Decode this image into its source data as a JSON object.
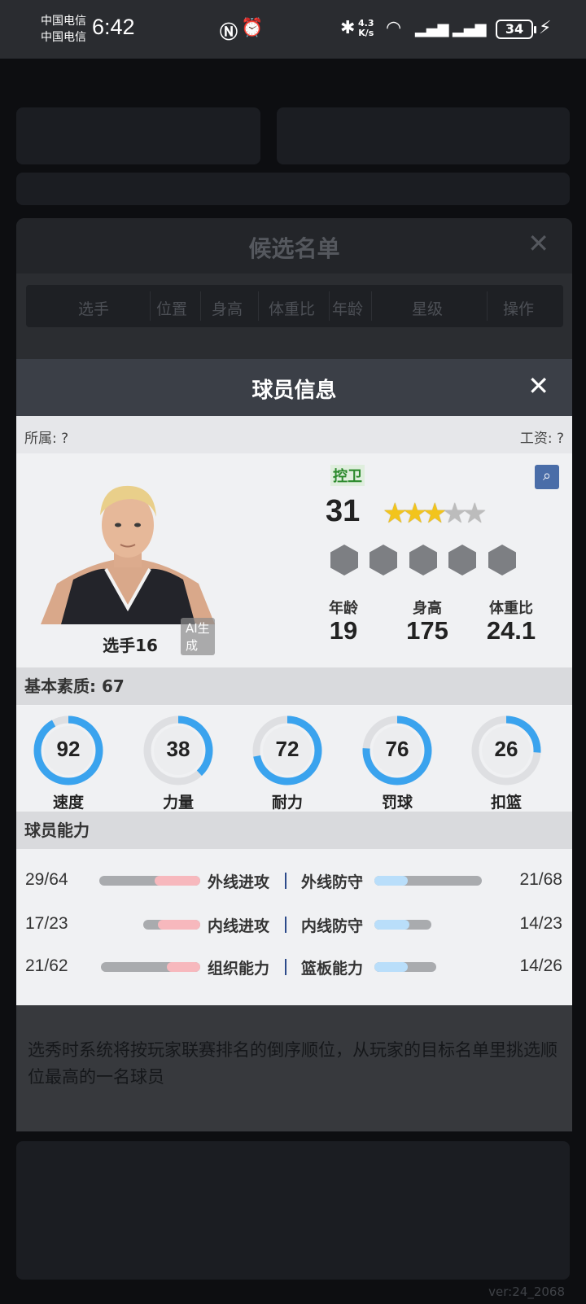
{
  "status_bar": {
    "carrier1": "中国电信",
    "carrier2": "中国电信",
    "time": "6:42",
    "net_speed_top": "4.3",
    "net_speed_bottom": "K/s",
    "battery": "34"
  },
  "candidate_list": {
    "title": "候选名单",
    "columns": [
      "选手",
      "位置",
      "身高",
      "体重比",
      "年龄",
      "星级",
      "操作"
    ],
    "description": "选秀时系统将按玩家联赛排名的倒序顺位，从玩家的目标名单里挑选顺位最高的一名球员"
  },
  "dialog": {
    "title": "球员信息",
    "affiliation": "所属: ?",
    "salary": "工资: ?",
    "player": {
      "name": "选手16",
      "ai_tag": "AI生成",
      "position": "控卫",
      "rating": "31",
      "stars_filled": 3,
      "stars_total": 5,
      "age_label": "年龄",
      "age": "19",
      "height_label": "身高",
      "height": "175",
      "weight_label": "体重比",
      "weight": "24.1"
    },
    "basic_quality_title": "基本素质: 67",
    "attributes": [
      {
        "label": "速度",
        "value": 92
      },
      {
        "label": "力量",
        "value": 38
      },
      {
        "label": "耐力",
        "value": 72
      },
      {
        "label": "罚球",
        "value": 76
      },
      {
        "label": "扣篮",
        "value": 26
      }
    ],
    "abilities_title": "球员能力",
    "abilities": [
      {
        "left_name": "外线进攻",
        "left_value": "29/64",
        "right_name": "外线防守",
        "right_value": "21/68"
      },
      {
        "left_name": "内线进攻",
        "left_value": "17/23",
        "right_name": "内线防守",
        "right_value": "14/23"
      },
      {
        "left_name": "组织能力",
        "left_value": "21/62",
        "right_name": "篮板能力",
        "right_value": "14/26"
      }
    ]
  },
  "version": "ver:24_2068",
  "colors": {
    "gauge_blue": "#3aa3ee",
    "attack_pink": "#f7b8bd",
    "defense_blue": "#b9defa",
    "position_green": "#2c8a2c"
  }
}
